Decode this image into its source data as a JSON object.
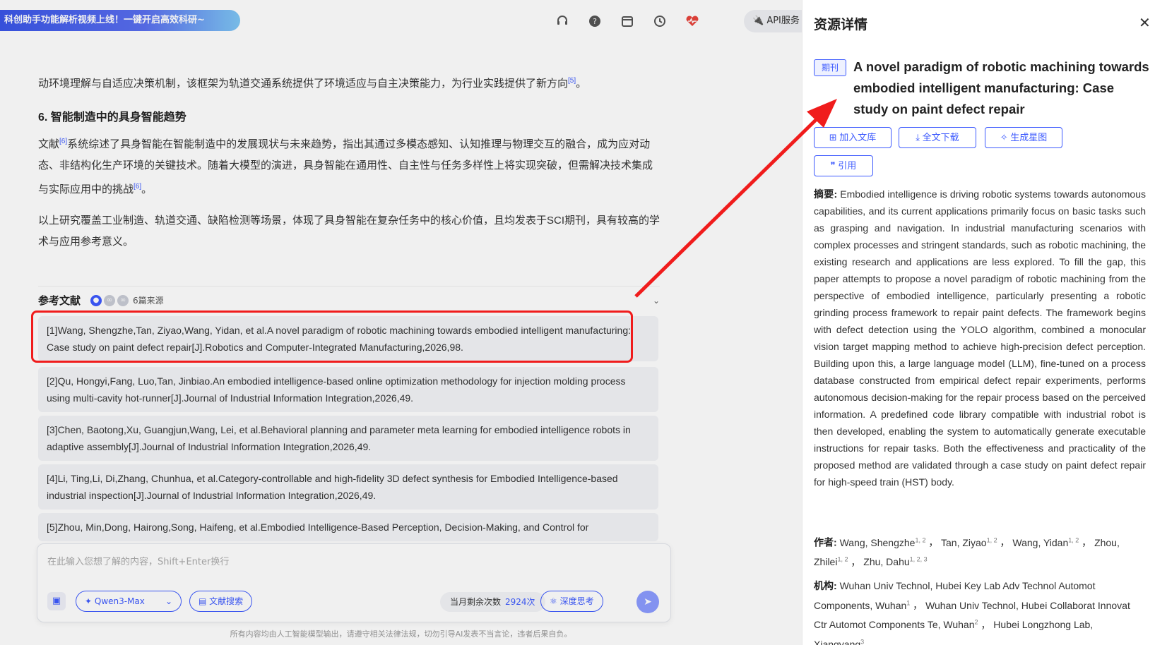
{
  "banner": "科创助手功能解析视频上线！一键开启高效科研~",
  "topbar": {
    "api_label": "API服务"
  },
  "content": {
    "p1": "动环境理解与自适应决策机制，该框架为轨道交通系统提供了环境适应与自主决策能力，为行业实践提供了新方向",
    "p1_ref": "[5]",
    "p1_end": "。",
    "section_heading": "6. 智能制造中的具身智能趋势",
    "p2_a": "文献",
    "p2_ref1": "[6]",
    "p2_b": "系统综述了具身智能在智能制造中的发展现状与未来趋势，指出其通过多模态感知、认知推理与物理交互的融合，成为应对动态、非结构化生产环境的关键技术。随着大模型的演进，具身智能在通用性、自主性与任务多样性上将实现突破，但需解决技术集成与实际应用中的挑战",
    "p2_ref2": "[6]",
    "p2_end": "。",
    "p3": "以上研究覆盖工业制造、轨道交通、缺陷检测等场景，体现了具身智能在复杂任务中的核心价值，且均发表于SCI期刊，具有较高的学术与应用参考意义。"
  },
  "references": {
    "title": "参考文献",
    "count": "6篇来源",
    "items": [
      "[1]Wang, Shengzhe,Tan, Ziyao,Wang, Yidan, et al.A novel paradigm of robotic machining towards embodied intelligent manufacturing: Case study on paint defect repair[J].Robotics and Computer-Integrated Manufacturing,2026,98.",
      "[2]Qu, Hongyi,Fang, Luo,Tan, Jinbiao.An embodied intelligence-based online optimization methodology for injection molding process using multi-cavity hot-runner[J].Journal of Industrial Information Integration,2026,49.",
      "[3]Chen, Baotong,Xu, Guangjun,Wang, Lei, et al.Behavioral planning and parameter meta learning for embodied intelligence robots in adaptive assembly[J].Journal of Industrial Information Integration,2026,49.",
      "[4]Li, Ting,Li, Di,Zhang, Chunhua, et al.Category-controllable and high-fidelity 3D defect synthesis for Embodied Intelligence-based industrial inspection[J].Journal of Industrial Information Integration,2026,49.",
      "[5]Zhou, Min,Dong, Hairong,Song, Haifeng, et al.Embodied Intelligence-Based Perception, Decision-Making, and Control for"
    ]
  },
  "input": {
    "placeholder": "在此输入您想了解的内容，Shift+Enter换行",
    "model": "Qwen3-Max",
    "literature_search": "文献搜索",
    "quota_label": "当月剩余次数",
    "quota_value": "2924次",
    "deep_think": "深度思考"
  },
  "disclaimer": "所有内容均由人工智能模型输出，请遵守相关法律法规，切勿引导AI发表不当言论，违者后果自负。",
  "panel": {
    "title": "资源详情",
    "badge": "期刊",
    "paper_title": "A novel paradigm of robotic machining towards embodied intelligent manufacturing: Case study on paint defect repair",
    "buttons": {
      "add_library": "加入文库",
      "download": "全文下载",
      "star_map": "生成星图",
      "cite": "引用"
    },
    "abstract_label": "摘要:",
    "abstract": "Embodied intelligence is driving robotic systems towards autonomous capabilities, and its current applications primarily focus on basic tasks such as grasping and navigation. In industrial manufacturing scenarios with complex processes and stringent standards, such as robotic machining, the existing research and applications are less explored. To fill the gap, this paper attempts to propose a novel paradigm of robotic machining from the perspective of embodied intelligence, particularly presenting a robotic grinding process framework to repair paint defects. The framework begins with defect detection using the YOLO algorithm, combined a monocular vision target mapping method to achieve high-precision defect perception. Building upon this, a large language model (LLM), fine-tuned on a process database constructed from empirical defect repair experiments, performs autonomous decision-making for the repair process based on the perceived information. A predefined code library compatible with industrial robot is then developed, enabling the system to automatically generate executable instructions for repair tasks. Both the effectiveness and practicality of the proposed method are validated through a case study on paint defect repair for high-speed train (HST) body.",
    "authors_label": "作者:",
    "authors": [
      {
        "name": "Wang, Shengzhe",
        "sup": "1, 2"
      },
      {
        "name": "Tan, Ziyao",
        "sup": "1, 2"
      },
      {
        "name": "Wang, Yidan",
        "sup": "1, 2"
      },
      {
        "name": "Zhou, Zhilei",
        "sup": "1, 2"
      },
      {
        "name": "Zhu, Dahu",
        "sup": "1, 2, 3"
      }
    ],
    "affil_label": "机构:",
    "affiliations": [
      {
        "name": "Wuhan Univ Technol, Hubei Key Lab Adv Technol Automot Components, Wuhan",
        "sup": "1"
      },
      {
        "name": "Wuhan Univ Technol, Hubei Collaborat Innovat Ctr Automot Components Te, Wuhan",
        "sup": "2"
      },
      {
        "name": "Hubei Longzhong Lab, Xiangyang",
        "sup": "3"
      }
    ]
  },
  "colors": {
    "accent": "#3d5afe",
    "highlight": "#f01c1c"
  }
}
